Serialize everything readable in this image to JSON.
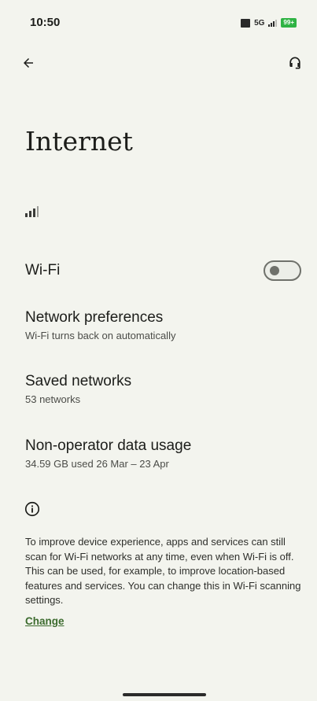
{
  "status_bar": {
    "time": "10:50",
    "network_type": "5G",
    "battery": "99+",
    "battery_color": "#2fb344"
  },
  "header": {
    "back_icon": "arrow-back-icon",
    "help_icon": "help-feedback-icon",
    "title": "Internet"
  },
  "cell_signal": {
    "icon": "cell-signal-icon",
    "bars": 3,
    "max_bars": 4
  },
  "wifi": {
    "label": "Wi-Fi",
    "enabled": false
  },
  "rows": {
    "network_preferences": {
      "title": "Network preferences",
      "subtitle": "Wi-Fi turns back on automatically"
    },
    "saved_networks": {
      "title": "Saved networks",
      "subtitle": "53 networks"
    },
    "data_usage": {
      "title": "Non-operator data usage",
      "subtitle": "34.59 GB used 26 Mar – 23 Apr"
    }
  },
  "info": {
    "icon": "info-icon",
    "text": "To improve device experience, apps and services can still scan for Wi-Fi networks at any time, even when Wi-Fi is off. This can be used, for example, to improve location-based features and services. You can change this in Wi-Fi scanning settings.",
    "link_label": "Change",
    "link_color": "#3c6b2e"
  }
}
